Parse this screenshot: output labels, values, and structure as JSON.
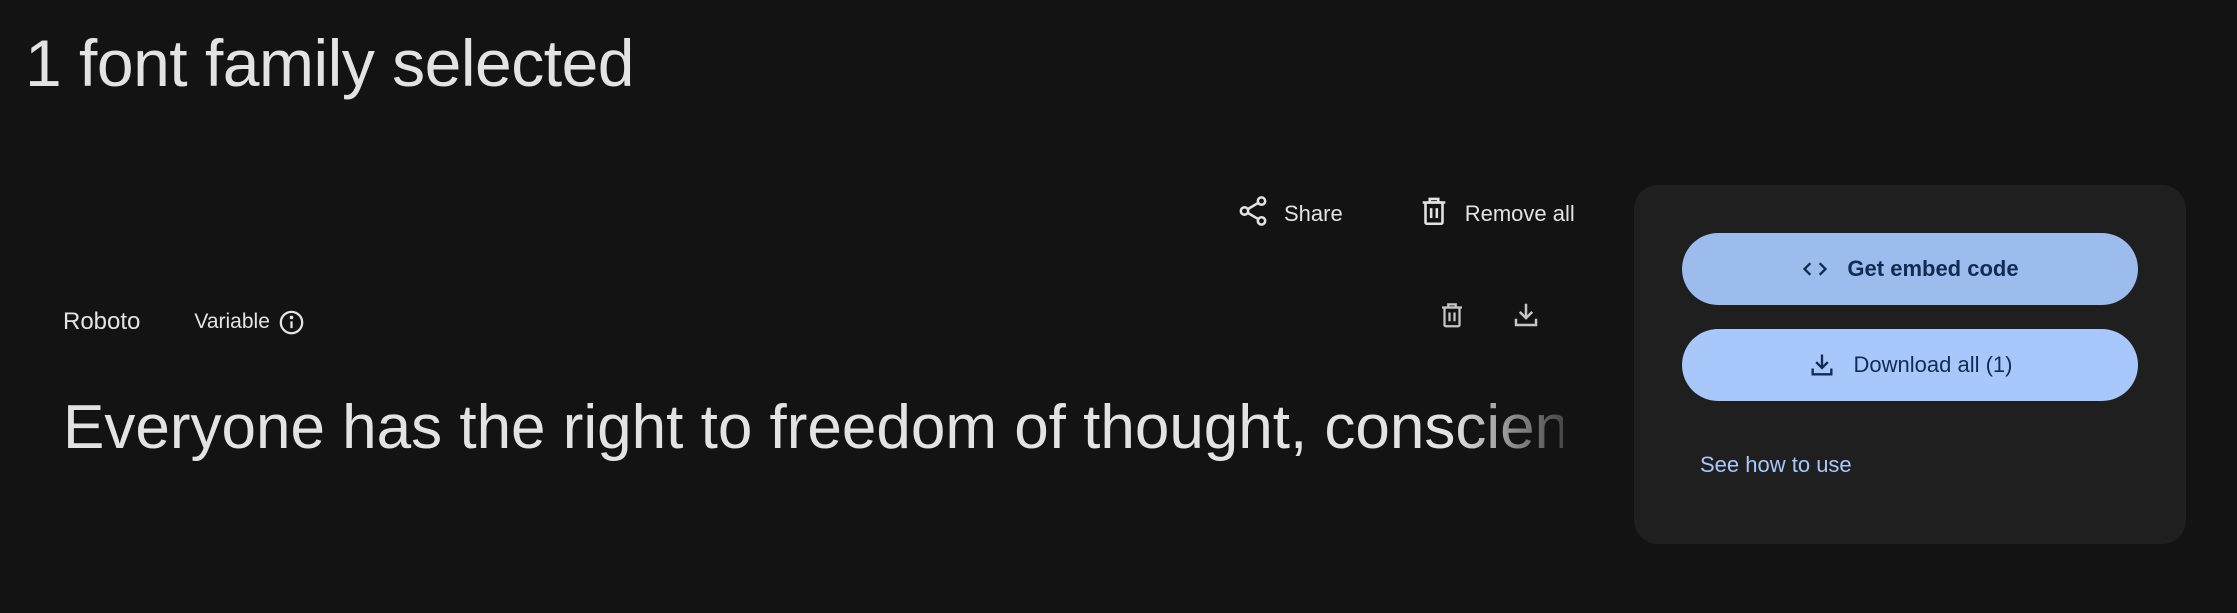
{
  "header": {
    "title": "1 font family selected"
  },
  "actions": {
    "share_label": "Share",
    "remove_all_label": "Remove all"
  },
  "family": {
    "name": "Roboto",
    "variable_label": "Variable",
    "preview_text": "Everyone has the right to freedom of thought, conscience and religion"
  },
  "panel": {
    "embed_label": "Get embed code",
    "download_label": "Download all (1)",
    "see_how_label": "See how to use"
  },
  "icons": {
    "share": "share-icon",
    "remove_all": "trash-icon",
    "info": "info-icon",
    "remove_family": "trash-icon",
    "download_family": "download-icon",
    "embed": "code-icon",
    "download_all": "download-icon"
  },
  "colors": {
    "background": "#131313",
    "panel": "#1f1f1f",
    "text": "#e3e3e3",
    "primary_button": "#a8c7fa",
    "link": "#a8c7fa"
  }
}
